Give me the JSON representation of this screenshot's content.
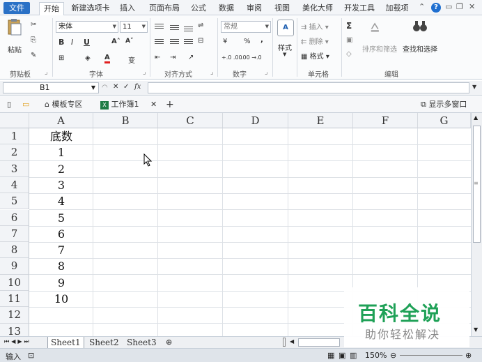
{
  "ribbon_tabs": [
    "文件",
    "开始",
    "新建选项卡",
    "插入",
    "页面布局",
    "公式",
    "数据",
    "审阅",
    "视图",
    "美化大师",
    "开发工具",
    "加载项"
  ],
  "ribbon": {
    "paste_label": "粘贴",
    "font_name": "宋体",
    "font_size": "11",
    "bold": "B",
    "italic": "I",
    "underline": "U",
    "grow_font": "A˄",
    "shrink_font": "A˅",
    "font_color": "A",
    "phonetic": "变",
    "number_format": "常规",
    "percent": "%",
    "comma": ",",
    "inc_decimal": "+.0 .00",
    "dec_decimal": ".00 →.0",
    "styles_label": "样式",
    "insert_label": "插入",
    "delete_label": "删除",
    "format_label": "格式",
    "sum_label": "Σ",
    "sort_filter_label": "排序和筛选",
    "find_select_label": "查找和选择",
    "groups": {
      "clipboard": "剪贴板",
      "font": "字体",
      "alignment": "对齐方式",
      "number": "数字",
      "cells": "单元格",
      "editing": "编辑"
    }
  },
  "formula_bar": {
    "name_box": "B1",
    "fx": "fx",
    "content": ""
  },
  "doc_tabs": {
    "templates": "模板专区",
    "workbook": "工作簿1",
    "show_multi_window": "显示多窗口"
  },
  "columns": [
    "A",
    "B",
    "C",
    "D",
    "E",
    "F",
    "G"
  ],
  "rows": [
    "1",
    "2",
    "3",
    "4",
    "5",
    "6",
    "7",
    "8",
    "9",
    "10",
    "11",
    "12",
    "13"
  ],
  "cells_A": [
    "底数",
    "1",
    "2",
    "3",
    "4",
    "5",
    "6",
    "7",
    "8",
    "9",
    "10",
    "",
    ""
  ],
  "sheets": [
    "Sheet1",
    "Sheet2",
    "Sheet3"
  ],
  "status": {
    "mode": "输入",
    "zoom": "150%"
  },
  "watermark": {
    "title": "百科全说",
    "subtitle": "助你轻松解决"
  },
  "colors": {
    "file_tab": "#2a71c6",
    "watermark_green": "#1fa157"
  }
}
